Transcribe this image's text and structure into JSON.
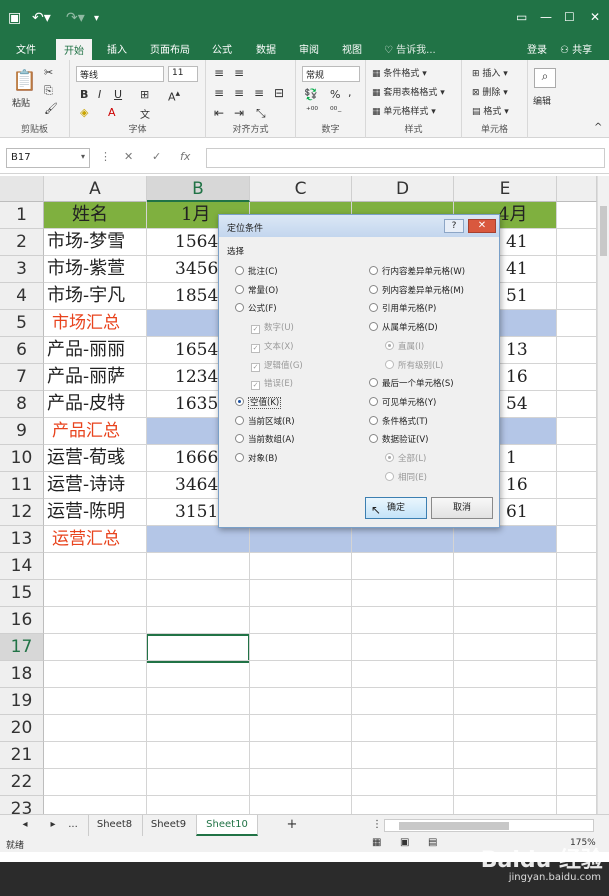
{
  "titlebar": {
    "save_icon": "save-icon",
    "undo_icon": "undo-icon",
    "redo_icon": "redo-icon",
    "customize_icon": "customize-icon"
  },
  "menu": {
    "tabs": [
      "文件",
      "开始",
      "插入",
      "页面布局",
      "公式",
      "数据",
      "审阅",
      "视图"
    ],
    "active": "开始",
    "tellme": "告诉我...",
    "login": "登录",
    "share": "共享"
  },
  "ribbon": {
    "clipboard": {
      "paste": "粘贴",
      "label": "剪贴板"
    },
    "font": {
      "name": "等线",
      "size": "11",
      "label": "字体",
      "bold": "B",
      "italic": "I",
      "underline": "U"
    },
    "align": {
      "label": "对齐方式"
    },
    "number": {
      "format": "常规",
      "label": "数字",
      "percent": "%",
      "comma": ","
    },
    "styles": {
      "cond": "条件格式",
      "table": "套用表格格式",
      "cell": "单元格样式",
      "label": "样式"
    },
    "cells": {
      "insert": "插入",
      "delete": "删除",
      "format": "格式",
      "label": "单元格"
    },
    "edit": {
      "label": "编辑"
    }
  },
  "formula": {
    "namebox": "B17",
    "fx": "fx",
    "cancel": "✕",
    "ok": "✓"
  },
  "columns": [
    "A",
    "B",
    "C",
    "D",
    "E"
  ],
  "rows": [
    {
      "n": "1",
      "a": "姓名",
      "b": "1月",
      "e": "4月",
      "type": "header"
    },
    {
      "n": "2",
      "a": "市场-梦雪",
      "b": "1564",
      "e": "41",
      "type": "data"
    },
    {
      "n": "3",
      "a": "市场-紫萱",
      "b": "3456",
      "e": "41",
      "type": "data"
    },
    {
      "n": "4",
      "a": "市场-宇凡",
      "b": "1854",
      "e": "51",
      "type": "data"
    },
    {
      "n": "5",
      "a": "市场汇总",
      "type": "sum"
    },
    {
      "n": "6",
      "a": "产品-丽丽",
      "b": "1654",
      "e": "13",
      "type": "data"
    },
    {
      "n": "7",
      "a": "产品-丽萨",
      "b": "1234",
      "e": "16",
      "type": "data"
    },
    {
      "n": "8",
      "a": "产品-皮特",
      "b": "1635",
      "e": "54",
      "type": "data"
    },
    {
      "n": "9",
      "a": "产品汇总",
      "type": "sum"
    },
    {
      "n": "10",
      "a": "运营-荀彧",
      "b": "1666",
      "e": "1",
      "type": "data"
    },
    {
      "n": "11",
      "a": "运营-诗诗",
      "b": "3464",
      "e": "16",
      "type": "data"
    },
    {
      "n": "12",
      "a": "运营-陈明",
      "b": "3151",
      "e": "61",
      "type": "data"
    },
    {
      "n": "13",
      "a": "运营汇总",
      "type": "sum"
    },
    {
      "n": "14",
      "type": "empty"
    },
    {
      "n": "15",
      "type": "empty"
    },
    {
      "n": "16",
      "type": "empty"
    },
    {
      "n": "17",
      "type": "empty"
    },
    {
      "n": "18",
      "type": "empty"
    },
    {
      "n": "19",
      "type": "empty"
    },
    {
      "n": "20",
      "type": "empty"
    },
    {
      "n": "21",
      "type": "empty"
    },
    {
      "n": "22",
      "type": "empty"
    },
    {
      "n": "23",
      "type": "empty"
    }
  ],
  "colors": {
    "green": "#217346",
    "header_fill": "#7fb03f",
    "sum_fill": "#b4c6e7",
    "sum_text": "#e8431d"
  },
  "sheets": {
    "prev": "◂",
    "next": "▸",
    "more": "...",
    "tabs": [
      "Sheet8",
      "Sheet9",
      "Sheet10"
    ],
    "active": "Sheet10",
    "add": "+"
  },
  "status": {
    "ready": "就绪",
    "zoom": "175%"
  },
  "dialog": {
    "title": "定位条件",
    "help": "?",
    "close": "✕",
    "section": "选择",
    "left": [
      {
        "label": "批注(C)",
        "kind": "radio"
      },
      {
        "label": "常量(O)",
        "kind": "radio"
      },
      {
        "label": "公式(F)",
        "kind": "radio"
      },
      {
        "label": "数字(U)",
        "kind": "check",
        "dis": true
      },
      {
        "label": "文本(X)",
        "kind": "check",
        "dis": true
      },
      {
        "label": "逻辑值(G)",
        "kind": "check",
        "dis": true
      },
      {
        "label": "错误(E)",
        "kind": "check",
        "dis": true
      },
      {
        "label": "空值(K)",
        "kind": "radio",
        "on": true
      },
      {
        "label": "当前区域(R)",
        "kind": "radio"
      },
      {
        "label": "当前数组(A)",
        "kind": "radio"
      },
      {
        "label": "对象(B)",
        "kind": "radio"
      }
    ],
    "right": [
      {
        "label": "行内容差异单元格(W)",
        "kind": "radio"
      },
      {
        "label": "列内容差异单元格(M)",
        "kind": "radio"
      },
      {
        "label": "引用单元格(P)",
        "kind": "radio"
      },
      {
        "label": "从属单元格(D)",
        "kind": "radio"
      },
      {
        "label": "直属(I)",
        "kind": "radio",
        "dis": true,
        "on": true,
        "sub": true
      },
      {
        "label": "所有级别(L)",
        "kind": "radio",
        "dis": true,
        "sub": true
      },
      {
        "label": "最后一个单元格(S)",
        "kind": "radio"
      },
      {
        "label": "可见单元格(Y)",
        "kind": "radio"
      },
      {
        "label": "条件格式(T)",
        "kind": "radio"
      },
      {
        "label": "数据验证(V)",
        "kind": "radio"
      },
      {
        "label": "全部(L)",
        "kind": "radio",
        "dis": true,
        "on": true,
        "sub": true
      },
      {
        "label": "相同(E)",
        "kind": "radio",
        "dis": true,
        "sub": true
      }
    ],
    "ok": "确定",
    "cancel": "取消"
  },
  "watermark": {
    "brand": "Baidu 经验",
    "url": "jingyan.baidu.com"
  }
}
